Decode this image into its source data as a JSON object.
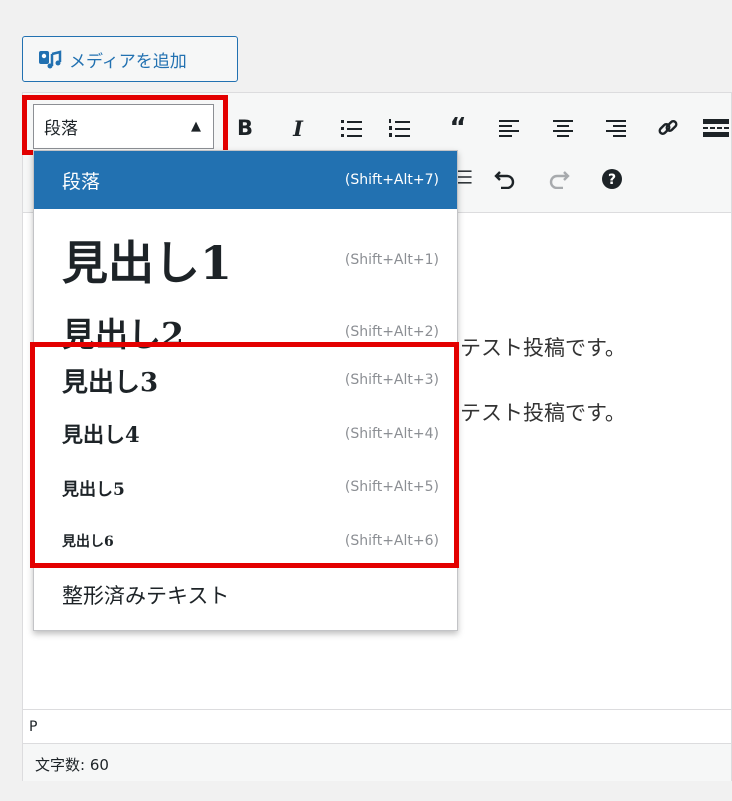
{
  "media_button": {
    "label": "メディアを追加",
    "icon": "add-media-icon"
  },
  "toolbar": {
    "format_select": {
      "value": "段落",
      "icon": "triangle-up-icon"
    },
    "row1_icons": [
      "bold-icon",
      "italic-icon",
      "bulleted-list-icon",
      "numbered-list-icon",
      "blockquote-icon",
      "align-left-icon",
      "align-center-icon",
      "align-right-icon",
      "link-icon",
      "more-tag-icon"
    ],
    "row2_icons": [
      "indent-icon",
      "undo-icon",
      "redo-icon",
      "help-icon"
    ],
    "bold_label": "B",
    "italic_label": "I"
  },
  "dropdown": {
    "items": [
      {
        "label": "段落",
        "shortcut": "(Shift+Alt+7)",
        "selected": true
      },
      {
        "label": "見出し1",
        "shortcut": "(Shift+Alt+1)"
      },
      {
        "label": "見出し2",
        "shortcut": "(Shift+Alt+2)"
      },
      {
        "label": "見出し3",
        "shortcut": "(Shift+Alt+3)"
      },
      {
        "label": "見出し4",
        "shortcut": "(Shift+Alt+4)"
      },
      {
        "label": "見出し5",
        "shortcut": "(Shift+Alt+5)"
      },
      {
        "label": "見出し6",
        "shortcut": "(Shift+Alt+6)"
      },
      {
        "label": "整形済みテキスト",
        "shortcut": ""
      }
    ]
  },
  "content": {
    "lines": [
      "テスト投稿です。",
      "テスト投稿です。"
    ]
  },
  "status": {
    "path": "P",
    "word_count": "文字数: 60"
  },
  "colors": {
    "accent": "#2271b1",
    "highlight": "#e30000"
  }
}
